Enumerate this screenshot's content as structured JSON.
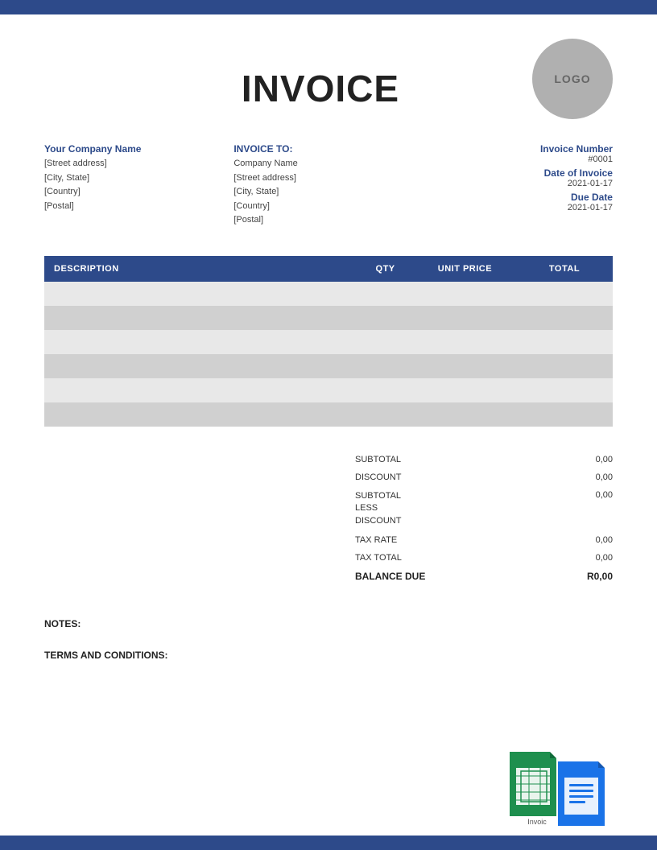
{
  "topBar": {},
  "header": {
    "title": "INVOICE",
    "logo": "LOGO"
  },
  "fromAddress": {
    "companyName": "Your Company Name",
    "lines": [
      "[Street address]",
      "[City, State]",
      "[Country]",
      "[Postal]"
    ]
  },
  "toAddress": {
    "label": "INVOICE TO:",
    "companyName": "Company Name",
    "lines": [
      "[Street address]",
      "[City, State]",
      "[Country]",
      "[Postal]"
    ]
  },
  "invoiceMeta": {
    "numberLabel": "Invoice Number",
    "number": "#0001",
    "dateLabel": "Date of Invoice",
    "date": "2021-01-17",
    "dueDateLabel": "Due Date",
    "dueDate": "2021-01-17"
  },
  "table": {
    "headers": [
      "DESCRIPTION",
      "QTY",
      "UNIT PRICE",
      "TOTAL"
    ],
    "rows": [
      {
        "description": "",
        "qty": "",
        "unitPrice": "",
        "total": ""
      },
      {
        "description": "",
        "qty": "",
        "unitPrice": "",
        "total": ""
      },
      {
        "description": "",
        "qty": "",
        "unitPrice": "",
        "total": ""
      },
      {
        "description": "",
        "qty": "",
        "unitPrice": "",
        "total": ""
      },
      {
        "description": "",
        "qty": "",
        "unitPrice": "",
        "total": ""
      },
      {
        "description": "",
        "qty": "",
        "unitPrice": "",
        "total": ""
      }
    ]
  },
  "totals": {
    "subtotalLabel": "SUBTOTAL",
    "subtotalValue": "0,00",
    "discountLabel": "DISCOUNT",
    "discountValue": "0,00",
    "subtotalLessLabel": "SUBTOTAL LESS DISCOUNT",
    "subtotalLessValue": "0,00",
    "taxRateLabel": "TAX RATE",
    "taxRateValue": "0,00",
    "taxTotalLabel": "TAX TOTAL",
    "taxTotalValue": "0,00",
    "balanceDueLabel": "BALANCE DUE",
    "balanceDueValue": "R0,00"
  },
  "notes": {
    "label": "NOTES:"
  },
  "terms": {
    "label": "TERMS AND CONDITIONS:"
  },
  "appIcons": {
    "sheetsLabel": "Invoic",
    "docsLabel": ""
  }
}
